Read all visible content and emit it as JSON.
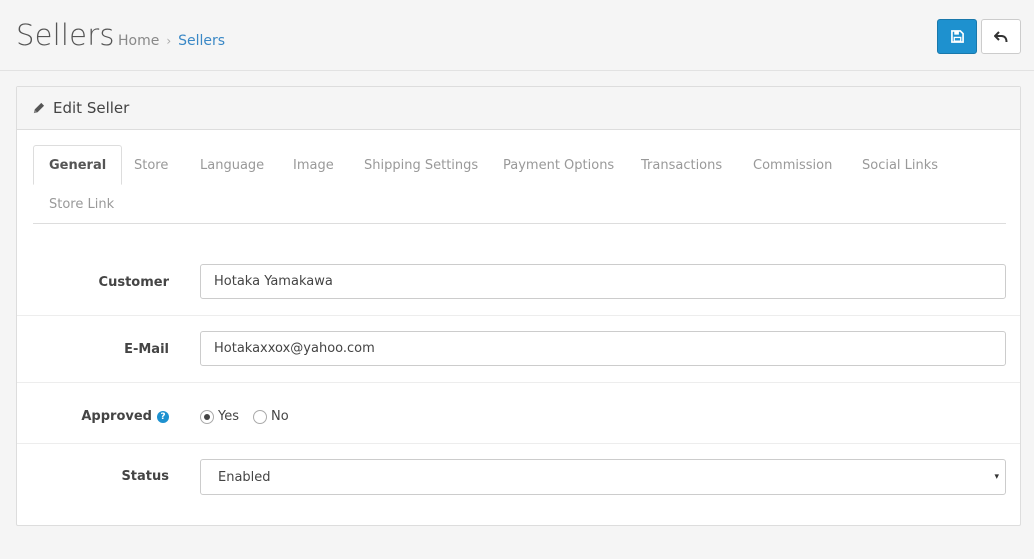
{
  "header": {
    "title": "Sellers",
    "breadcrumb": [
      {
        "label": "Home"
      },
      {
        "label": "Sellers"
      }
    ],
    "save_icon": "save-icon",
    "back_icon": "reply-icon"
  },
  "panel": {
    "title": "Edit Seller",
    "title_icon": "pencil-icon"
  },
  "tabs": [
    {
      "label": "General",
      "active": true
    },
    {
      "label": "Store"
    },
    {
      "label": "Language"
    },
    {
      "label": "Image"
    },
    {
      "label": "Shipping Settings"
    },
    {
      "label": "Payment Options"
    },
    {
      "label": "Transactions"
    },
    {
      "label": "Commission"
    },
    {
      "label": "Social Links"
    },
    {
      "label": "Store Link"
    }
  ],
  "form": {
    "customer": {
      "label": "Customer",
      "value": "Hotaka Yamakawa"
    },
    "email": {
      "label": "E-Mail",
      "value": "Hotakaxxox@yahoo.com"
    },
    "approved": {
      "label": "Approved",
      "help": "?",
      "options": [
        "Yes",
        "No"
      ],
      "selected": "Yes"
    },
    "status": {
      "label": "Status",
      "value": "Enabled",
      "caret": "▾"
    }
  },
  "colors": {
    "primary": "#1e91cf",
    "link": "#3a88c6",
    "background": "#f5f5f5"
  }
}
